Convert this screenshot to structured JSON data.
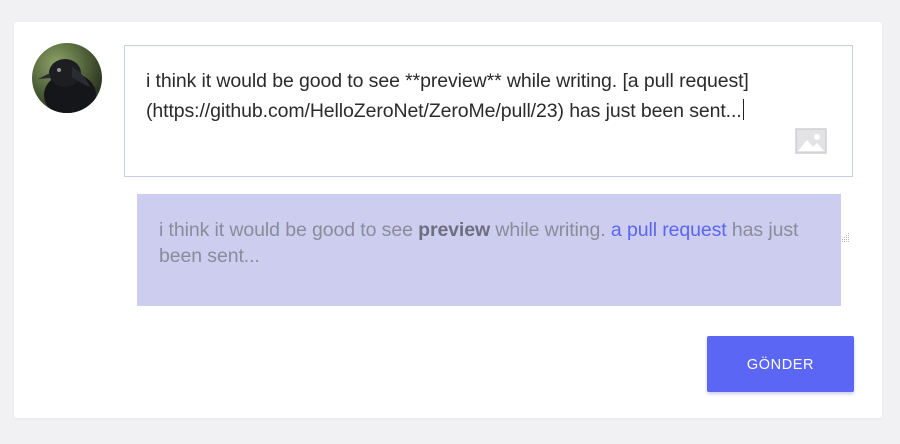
{
  "composer": {
    "text": "i think it would be good to see **preview** while writing. [a pull request](https://github.com/HelloZeroNet/ZeroMe/pull/23) has just been sent...",
    "image_icon": "image-icon"
  },
  "preview": {
    "before_bold": "i think it would be good to see ",
    "bold": "preview",
    "after_bold": " while writing. ",
    "link_text": "a pull request",
    "after_link": " has just been sent..."
  },
  "actions": {
    "send_label": "GÖNDER"
  },
  "colors": {
    "accent": "#5b66f5",
    "preview_background": "#cdcdef",
    "link": "#5b66f0"
  }
}
